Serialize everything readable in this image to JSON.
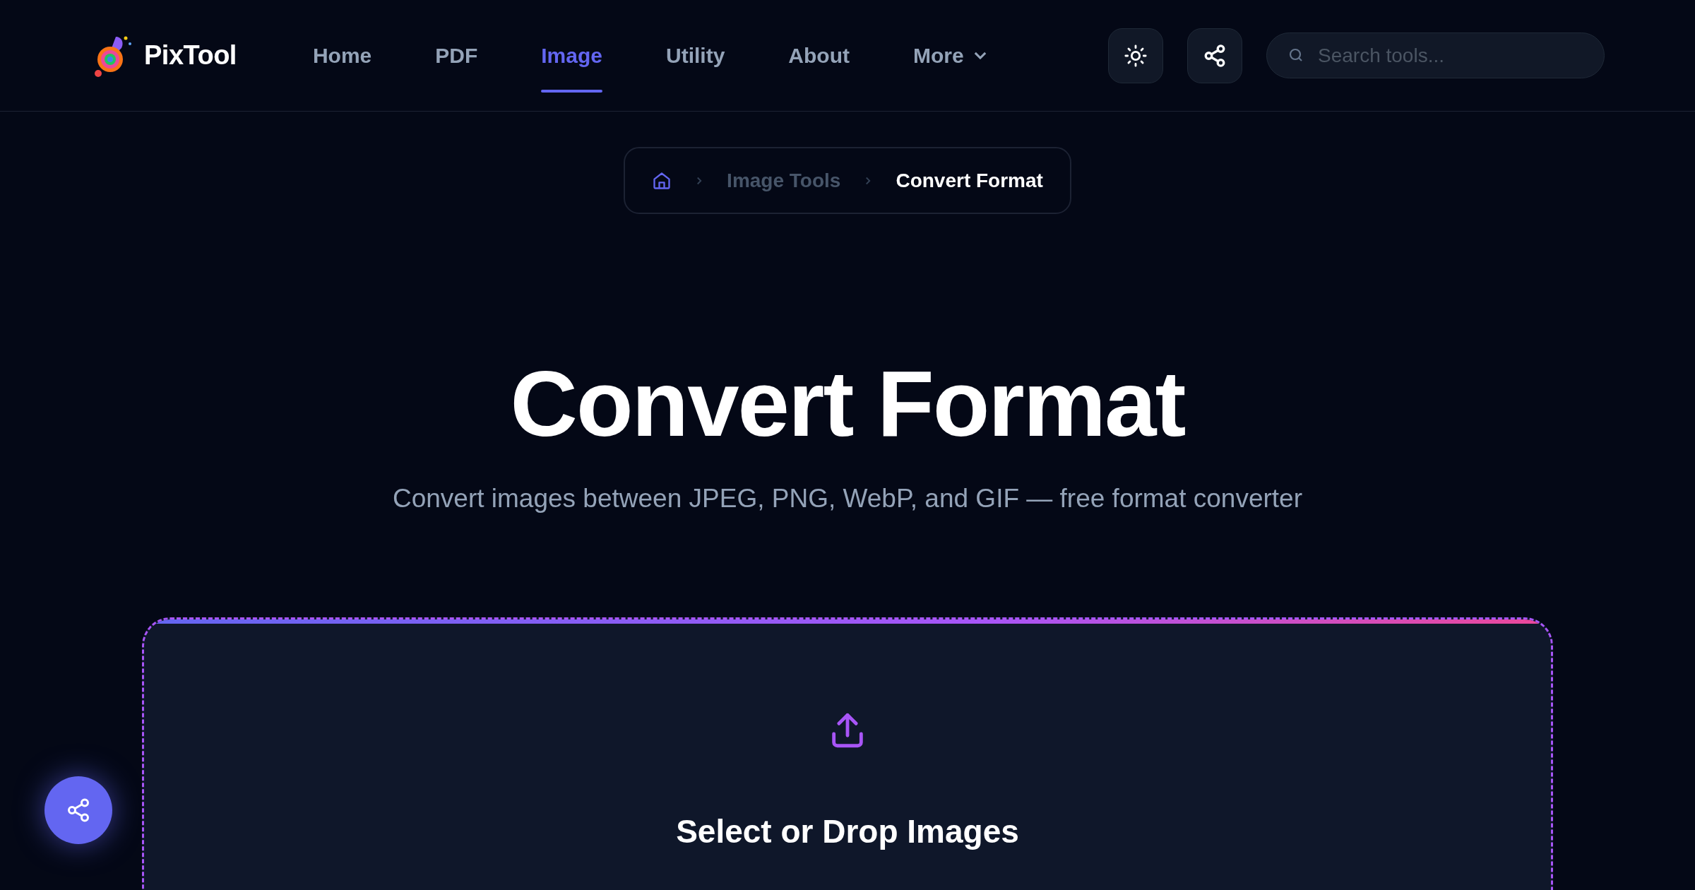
{
  "brand": {
    "name": "PixTool"
  },
  "nav": [
    {
      "label": "Home",
      "kind": "link",
      "selected": false
    },
    {
      "label": "PDF",
      "kind": "link",
      "selected": false
    },
    {
      "label": "Image",
      "kind": "link",
      "selected": true
    },
    {
      "label": "Utility",
      "kind": "link",
      "selected": false
    },
    {
      "label": "About",
      "kind": "link",
      "selected": false
    },
    {
      "label": "More",
      "kind": "dropdown",
      "selected": false
    }
  ],
  "search": {
    "placeholder": "Search tools..."
  },
  "breadcrumb": [
    {
      "label": "Image Tools",
      "current": false
    },
    {
      "label": "Convert Format",
      "current": true
    }
  ],
  "hero": {
    "title": "Convert Format",
    "subtitle": "Convert images between JPEG, PNG, WebP, and GIF — free format converter"
  },
  "dropzone": {
    "title": "Select or Drop Images"
  }
}
